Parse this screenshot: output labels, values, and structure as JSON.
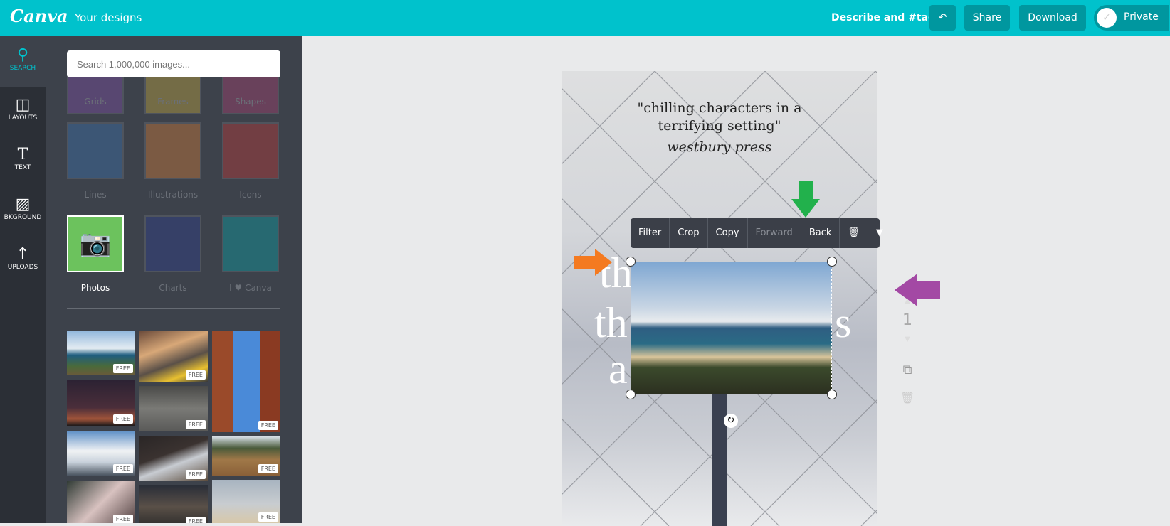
{
  "header": {
    "logo": "Canva",
    "your_designs": "Your designs",
    "describe": "Describe and #tag",
    "undo_icon": "undo-icon",
    "share": "Share",
    "download": "Download",
    "privacy": "Private"
  },
  "rail": [
    {
      "label": "SEARCH",
      "icon": "search-icon"
    },
    {
      "label": "LAYOUTS",
      "icon": "layouts-icon"
    },
    {
      "label": "TEXT",
      "icon": "text-icon"
    },
    {
      "label": "BKGROUND",
      "icon": "background-icon"
    },
    {
      "label": "UPLOADS",
      "icon": "upload-icon"
    }
  ],
  "search": {
    "placeholder": "Search 1,000,000 images..."
  },
  "categories": [
    "Grids",
    "Frames",
    "Shapes",
    "Lines",
    "Illustrations",
    "Icons",
    "Photos",
    "Charts",
    "I ♥ Canva"
  ],
  "photos": {
    "badge": "FREE"
  },
  "design": {
    "quote1": "\"chilling characters in a",
    "quote2": "terrifying setting\"",
    "publisher": "westbury press",
    "fragments": [
      "th",
      "th",
      "s",
      "a"
    ]
  },
  "toolbar": {
    "filter": "Filter",
    "crop": "Crop",
    "copy": "Copy",
    "forward": "Forward",
    "back": "Back",
    "delete_icon": "trash-icon",
    "more_icon": "chevron-down-icon"
  },
  "page_controls": {
    "page_number": "1"
  },
  "colors": {
    "brand": "#00c2cc",
    "arrow_orange": "#f47a20",
    "arrow_green": "#22b14c",
    "arrow_purple": "#a349a4"
  }
}
